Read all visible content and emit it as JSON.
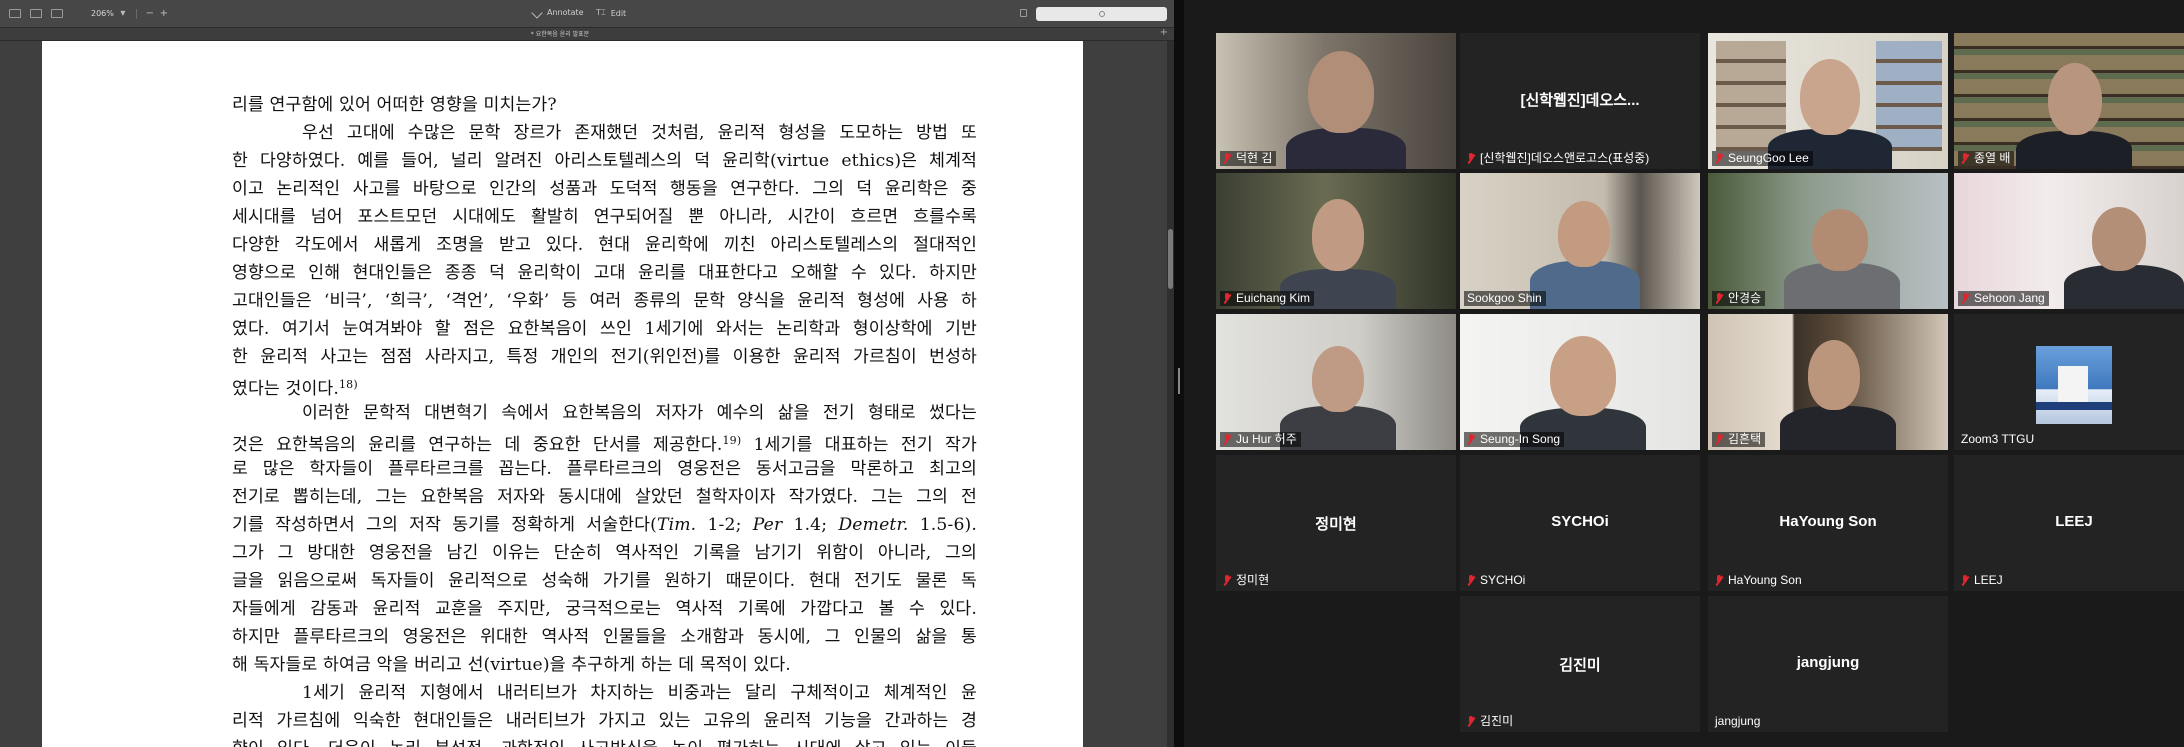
{
  "pdf": {
    "toolbar": {
      "zoom": "206%",
      "zoom_out": "−",
      "zoom_in": "+",
      "annotate": "Annotate",
      "edit": "Edit"
    },
    "tab_title": "* 요한복음 윤리 발표문",
    "tab_plus": "+",
    "lines": [
      "리를 연구함에 있어 어떠한 영향을 미치는가?",
      "우선 고대에 수많은 문학 장르가 존재했던 것처럼, 윤리적 형성을 도모하는 방법 또",
      "한 다양하였다. 예를 들어, 널리 알려진 아리스토텔레스의 덕 윤리학(virtue ethics)은 체계적",
      "이고 논리적인 사고를 바탕으로 인간의 성품과 도덕적 행동을 연구한다. 그의 덕 윤리학은 중",
      "세시대를 넘어 포스트모던 시대에도 활발히 연구되어질 뿐 아니라, 시간이 흐르면 흐를수록",
      "다양한 각도에서 새롭게 조명을 받고 있다. 현대 윤리학에 끼친 아리스토텔레스의 절대적인",
      "영향으로 인해 현대인들은 종종 덕 윤리학이 고대 윤리를 대표한다고 오해할 수 있다. 하지만",
      "고대인들은 ‘비극’, ‘희극’, ‘격언’, ‘우화’ 등 여러 종류의 문학 양식을 윤리적 형성에 사용 하",
      "였다. 여기서 눈여겨봐야 할 점은 요한복음이 쓰인 1세기에 와서는 논리학과 형이상학에 기반",
      "한 윤리적 사고는 점점 사라지고, 특정 개인의 전기(위인전)를 이용한 윤리적 가르침이 번성하",
      "였다는 것이다.",
      "이러한 문학적 대변혁기 속에서 요한복음의 저자가 예수의 삶을 전기 형태로 썼다는",
      "것은 요한복음의 윤리를 연구하는 데 중요한 단서를 제공한다.",
      "로 많은 학자들이 플루타르크를 꼽는다. 플루타르크의 영웅전은 동서고금을 막론하고 최고의",
      "전기로 뽑히는데, 그는 요한복음 저자와 동시대에 살았던 철학자이자 작가였다. 그는 그의 전",
      "기를 작성하면서 그의 저작 동기를 정확하게 서술한다(",
      "그가 그 방대한 영웅전을 남긴 이유는 단순히 역사적인 기록을 남기기 위함이 아니라, 그의",
      "글을 읽음으로써 독자들이 윤리적으로 성숙해 가기를 원하기 때문이다. 현대 전기도 물론 독",
      "자들에게 감동과 윤리적 교훈을 주지만, 궁극적으로는 역사적 기록에 가깝다고 볼 수 있다.",
      "하지만 플루타르크의 영웅전은 위대한 역사적 인물들을 소개함과 동시에, 그 인물의 삶을 통",
      "해 독자들로 하여금 악을 버리고 선(virtue)을 추구하게 하는 데 목적이 있다.",
      "1세기 윤리적 지형에서 내러티브가 차지하는 비중과는 달리 구체적이고 체계적인 윤",
      "리적 가르침에 익숙한 현대인들은 내러티브가 가지고 있는 고유의 윤리적 기능을 간과하는 경",
      "향이 있다. 더욱이 논리 분석적, 과학적인 사고방식을 높이 평가하는 시대에 살고 있는 이들"
    ],
    "fn18": "18)",
    "fn19": "19)",
    "line12_tail": " 1세기를 대표하는 전기 작가",
    "line15_i1": "Tim.",
    "line15_n1": " 1-2; ",
    "line15_i2": "Per",
    "line15_n2": " 1.4; ",
    "line15_i3": "Demetr.",
    "line15_n3": " 1.5-6)."
  },
  "zoom": {
    "tiles": [
      {
        "name": "덕현 김",
        "muted": true,
        "video": true
      },
      {
        "name": "[신학웹진]데오스앤로고스(표성중)",
        "big": "[신학웹진]데오스...",
        "muted": true,
        "video": false
      },
      {
        "name": "SeungGoo Lee",
        "muted": true,
        "video": true
      },
      {
        "name": "종열 배",
        "muted": true,
        "video": true
      },
      {
        "name": "Euichang Kim",
        "muted": true,
        "video": true
      },
      {
        "name": "Sookgoo Shin",
        "muted": false,
        "video": true,
        "active": true
      },
      {
        "name": "안경승",
        "muted": true,
        "video": true
      },
      {
        "name": "Sehoon Jang",
        "muted": true,
        "video": true
      },
      {
        "name": "Ju Hur 허주",
        "muted": true,
        "video": true
      },
      {
        "name": "Seung-In Song",
        "muted": true,
        "video": true
      },
      {
        "name": "김흔택",
        "muted": true,
        "video": true
      },
      {
        "name": "Zoom3 TTGU",
        "muted": false,
        "video": true
      },
      {
        "name": "정미현",
        "big": "정미현",
        "muted": true,
        "video": false
      },
      {
        "name": "SYCHOi",
        "big": "SYCHOi",
        "muted": true,
        "video": false
      },
      {
        "name": "HaYoung Son",
        "big": "HaYoung Son",
        "muted": true,
        "video": false
      },
      {
        "name": "LEEJ",
        "big": "LEEJ",
        "muted": true,
        "video": false
      },
      {
        "name": "김진미",
        "big": "김진미",
        "muted": true,
        "video": false
      },
      {
        "name": "jangjung",
        "big": "jangjung",
        "muted": false,
        "video": false
      }
    ]
  }
}
